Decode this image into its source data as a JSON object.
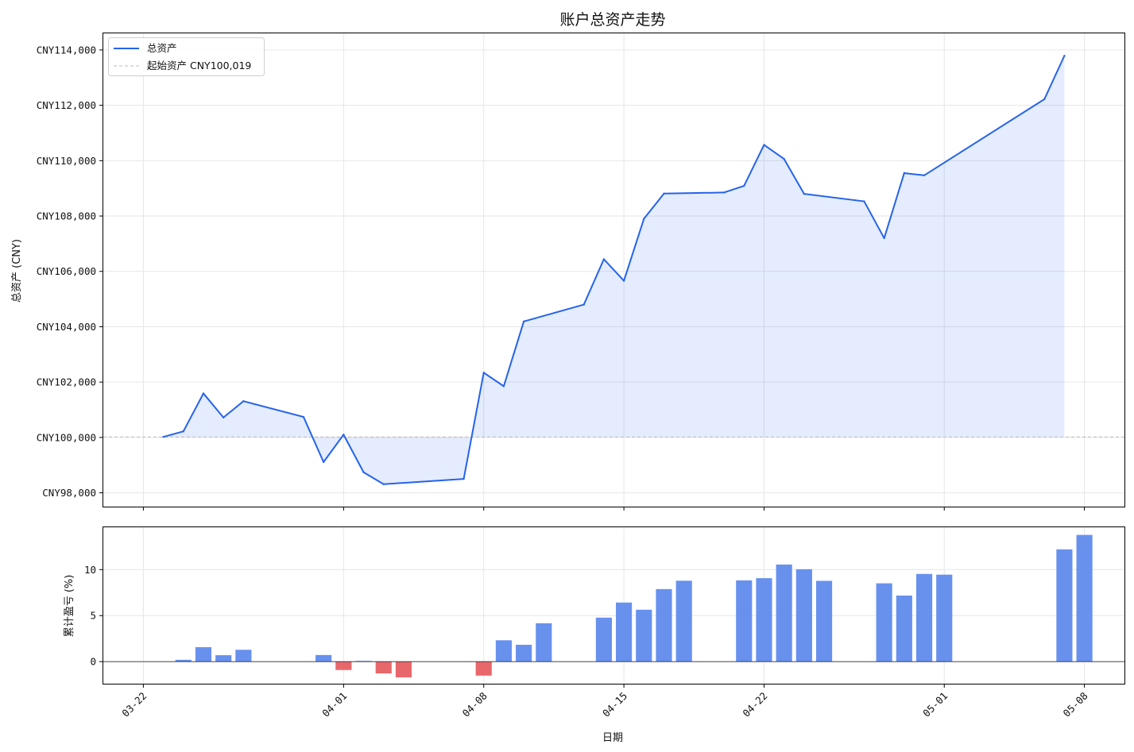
{
  "chart_data": [
    {
      "type": "line",
      "title": "账户总资产走势",
      "ylabel": "总资产 (CNY)",
      "ylim": [
        97500,
        114600
      ],
      "yticks": [
        98000,
        100000,
        102000,
        104000,
        106000,
        108000,
        110000,
        112000,
        114000
      ],
      "ytick_labels": [
        "CNY98,000",
        "CNY100,000",
        "CNY102,000",
        "CNY104,000",
        "CNY106,000",
        "CNY108,000",
        "CNY110,000",
        "CNY112,000",
        "CNY114,000"
      ],
      "grid": true,
      "legend_position": "top-left",
      "series": [
        {
          "name": "总资产",
          "color": "#2563eb",
          "fill": true,
          "points": [
            [
              "2025-03-23",
              100019
            ],
            [
              "2025-03-24",
              100220
            ],
            [
              "2025-03-25",
              101590
            ],
            [
              "2025-03-26",
              100720
            ],
            [
              "2025-03-27",
              101310
            ],
            [
              "2025-03-30",
              100740
            ],
            [
              "2025-03-31",
              99110
            ],
            [
              "2025-04-01",
              100100
            ],
            [
              "2025-04-02",
              98740
            ],
            [
              "2025-04-03",
              98310
            ],
            [
              "2025-04-07",
              98500
            ],
            [
              "2025-04-08",
              102340
            ],
            [
              "2025-04-09",
              101850
            ],
            [
              "2025-04-10",
              104190
            ],
            [
              "2025-04-13",
              104800
            ],
            [
              "2025-04-14",
              106440
            ],
            [
              "2025-04-15",
              105660
            ],
            [
              "2025-04-16",
              107900
            ],
            [
              "2025-04-17",
              108810
            ],
            [
              "2025-04-20",
              108850
            ],
            [
              "2025-04-21",
              109090
            ],
            [
              "2025-04-22",
              110570
            ],
            [
              "2025-04-23",
              110060
            ],
            [
              "2025-04-24",
              108800
            ],
            [
              "2025-04-27",
              108530
            ],
            [
              "2025-04-28",
              107200
            ],
            [
              "2025-04-29",
              109550
            ],
            [
              "2025-04-30",
              109470
            ],
            [
              "2025-05-06",
              112220
            ],
            [
              "2025-05-07",
              113790
            ]
          ]
        },
        {
          "name": "起始资产 CNY100,019",
          "type": "hline",
          "y": 100019,
          "color": "#bbbbbb",
          "style": "dashed"
        }
      ]
    },
    {
      "type": "bar",
      "xlabel": "日期",
      "ylabel": "累计盈亏 (%)",
      "ylim": [
        -2.4,
        14.6
      ],
      "yticks": [
        0,
        5,
        10
      ],
      "ytick_labels": [
        "0",
        "5",
        "10"
      ],
      "grid": true,
      "xticks": [
        "2025-03-22",
        "2025-04-01",
        "2025-04-08",
        "2025-04-15",
        "2025-04-22",
        "2025-05-01",
        "2025-05-08"
      ],
      "xtick_labels": [
        "03-22",
        "04-01",
        "04-08",
        "04-15",
        "04-22",
        "05-01",
        "05-08"
      ],
      "x_range": [
        "2025-03-20",
        "2025-05-10"
      ],
      "positive_color": "#6891ee",
      "negative_color": "#e8676b",
      "bars": [
        [
          "2025-03-24",
          0.2
        ],
        [
          "2025-03-25",
          1.57
        ],
        [
          "2025-03-26",
          0.7
        ],
        [
          "2025-03-27",
          1.29
        ],
        [
          "2025-03-31",
          0.72
        ],
        [
          "2025-04-01",
          -0.91
        ],
        [
          "2025-04-02",
          0.08
        ],
        [
          "2025-04-03",
          -1.28
        ],
        [
          "2025-04-04",
          -1.71
        ],
        [
          "2025-04-08",
          -1.52
        ],
        [
          "2025-04-09",
          2.32
        ],
        [
          "2025-04-10",
          1.83
        ],
        [
          "2025-04-11",
          4.17
        ],
        [
          "2025-04-14",
          4.78
        ],
        [
          "2025-04-15",
          6.42
        ],
        [
          "2025-04-16",
          5.64
        ],
        [
          "2025-04-17",
          7.88
        ],
        [
          "2025-04-18",
          8.79
        ],
        [
          "2025-04-21",
          8.83
        ],
        [
          "2025-04-22",
          9.07
        ],
        [
          "2025-04-23",
          10.55
        ],
        [
          "2025-04-24",
          10.04
        ],
        [
          "2025-04-25",
          8.78
        ],
        [
          "2025-04-28",
          8.51
        ],
        [
          "2025-04-29",
          7.18
        ],
        [
          "2025-04-30",
          9.53
        ],
        [
          "2025-05-01",
          9.45
        ],
        [
          "2025-05-07",
          12.2
        ],
        [
          "2025-05-08",
          13.77
        ]
      ]
    }
  ]
}
